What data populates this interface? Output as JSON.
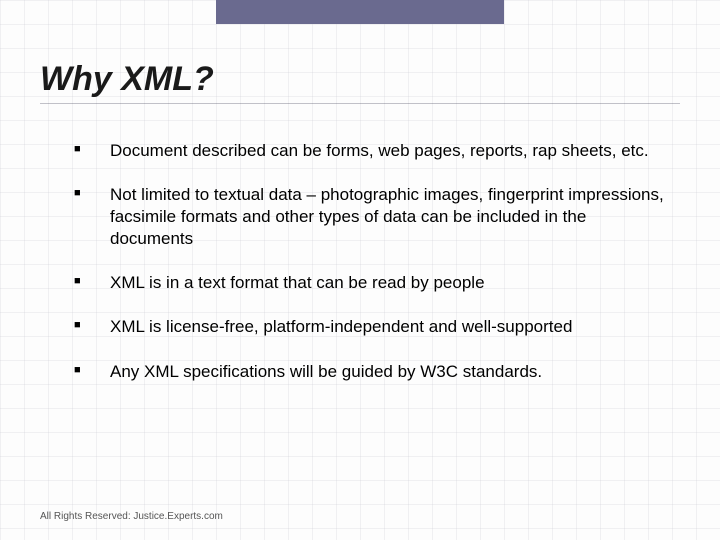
{
  "slide": {
    "title": "Why XML?",
    "bullets": [
      "Document described can be forms, web pages, reports, rap sheets, etc.",
      "Not limited to textual data – photographic images, fingerprint impressions, facsimile formats and other types of data can be included in the documents",
      "XML is in a text format that can be read by people",
      "XML is license-free, platform-independent and well-supported",
      "Any XML specifications will be guided by W3C standards."
    ],
    "footer": "All Rights Reserved: Justice.Experts.com",
    "bullet_glyph": "■"
  }
}
